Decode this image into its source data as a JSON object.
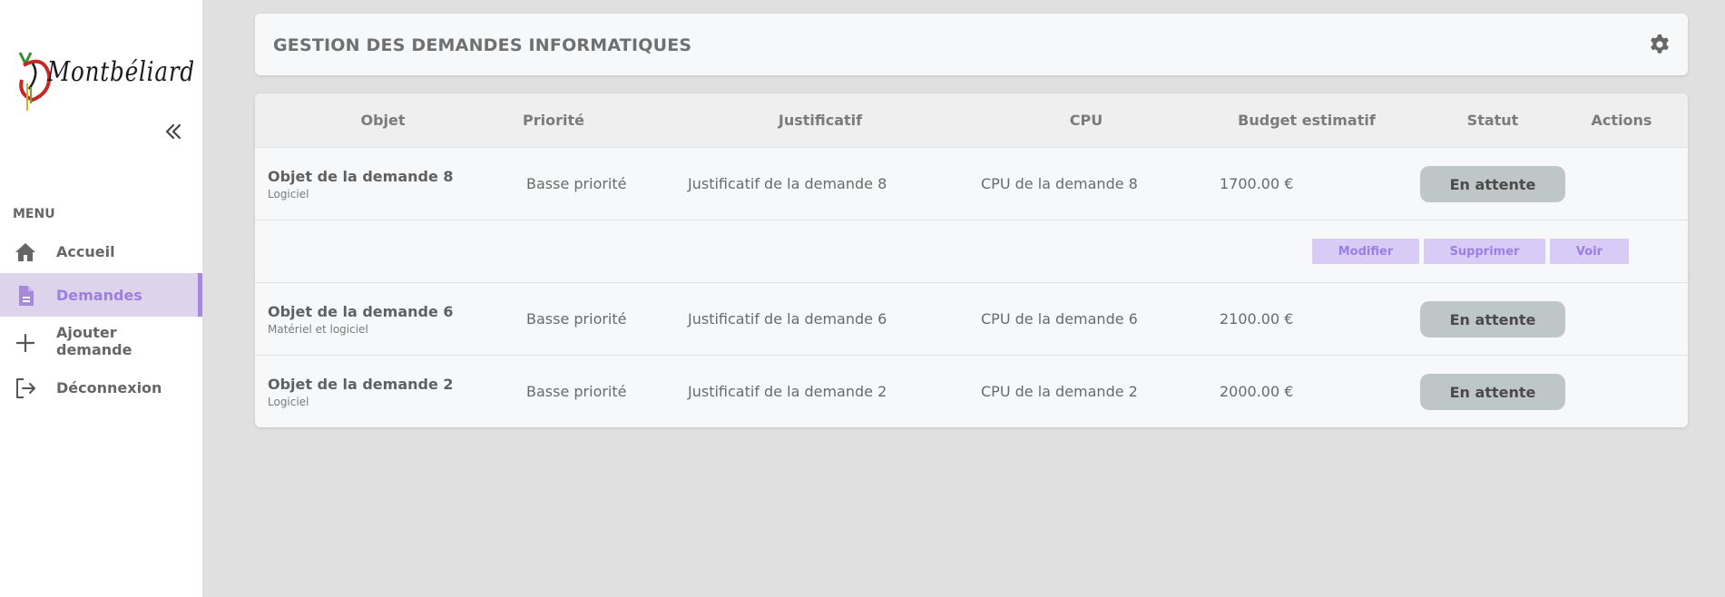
{
  "sidebar": {
    "logo_text": "Montbéliard",
    "menu_label": "MENU",
    "items": [
      {
        "label": "Accueil",
        "icon": "home-icon",
        "active": false
      },
      {
        "label": "Demandes",
        "icon": "document-icon",
        "active": true
      },
      {
        "label": "Ajouter demande",
        "icon": "plus-icon",
        "active": false
      },
      {
        "label": "Déconnexion",
        "icon": "logout-icon",
        "active": false
      }
    ]
  },
  "header": {
    "title": "GESTION DES DEMANDES INFORMATIQUES",
    "settings_icon": "gear-icon"
  },
  "table": {
    "columns": [
      "Objet",
      "Priorité",
      "Justificatif",
      "CPU",
      "Budget estimatif",
      "Statut",
      "Actions"
    ],
    "rows": [
      {
        "title": "Objet de la demande 8",
        "type": "Logiciel",
        "priority": "Basse priorité",
        "justification": "Justificatif de la demande 8",
        "cpu": "CPU de la demande 8",
        "budget": "1700.00 €",
        "status": "En attente",
        "expanded": true
      },
      {
        "title": "Objet de la demande 6",
        "type": "Matériel et logiciel",
        "priority": "Basse priorité",
        "justification": "Justificatif de la demande 6",
        "cpu": "CPU de la demande 6",
        "budget": "2100.00 €",
        "status": "En attente",
        "expanded": false
      },
      {
        "title": "Objet de la demande 2",
        "type": "Logiciel",
        "priority": "Basse priorité",
        "justification": "Justificatif de la demande 2",
        "cpu": "CPU de la demande 2",
        "budget": "2000.00 €",
        "status": "En attente",
        "expanded": false
      }
    ],
    "row_actions": {
      "edit": "Modifier",
      "delete": "Supprimer",
      "view": "Voir"
    }
  },
  "colors": {
    "accent": "#9c7fe0",
    "active_bg": "#ddd3ea",
    "status_bg": "#bfc6c6",
    "button_bg": "#d8cbf5",
    "page_bg": "#e0e0e0"
  }
}
